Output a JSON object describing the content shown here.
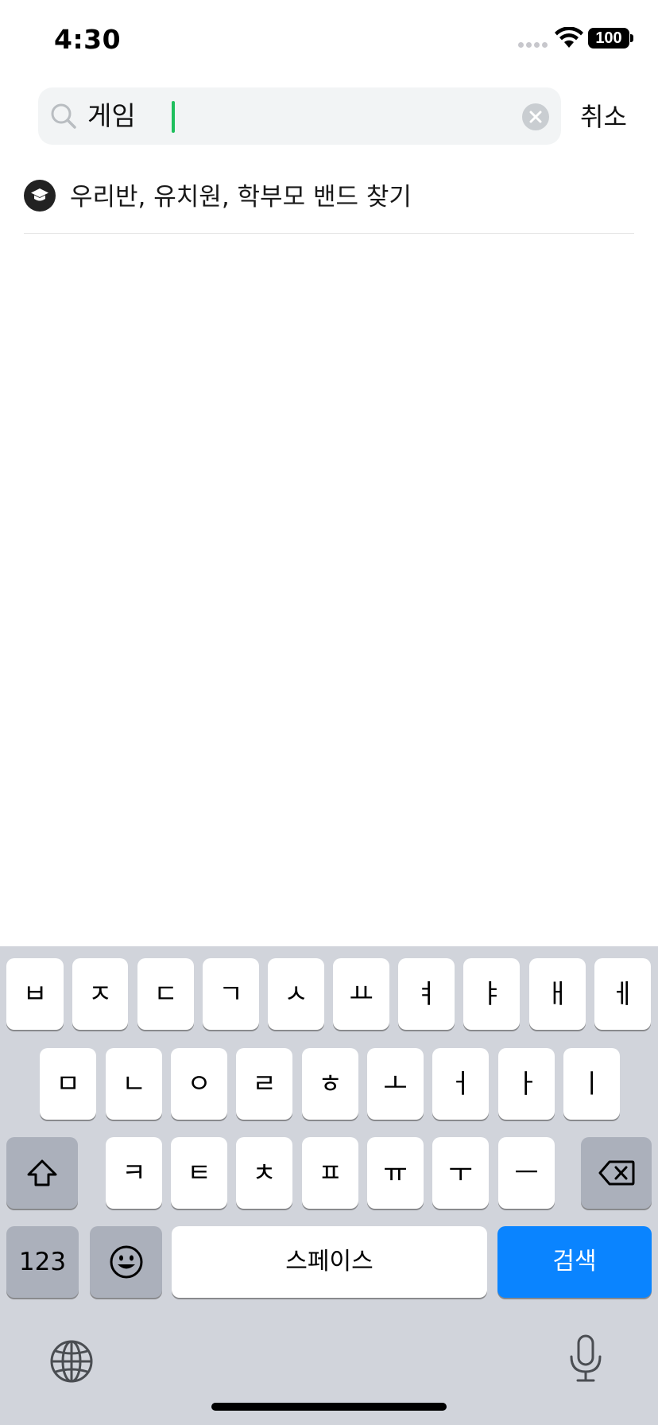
{
  "status_bar": {
    "time": "4:30",
    "battery": "100"
  },
  "search": {
    "query": "게임",
    "placeholder": "",
    "cancel_label": "취소"
  },
  "suggestion": {
    "icon": "graduation-cap-icon",
    "label": "우리반, 유치원, 학부모 밴드 찾기"
  },
  "keyboard": {
    "row1": [
      "ㅂ",
      "ㅈ",
      "ㄷ",
      "ㄱ",
      "ㅅ",
      "ㅛ",
      "ㅕ",
      "ㅑ",
      "ㅐ",
      "ㅔ"
    ],
    "row2": [
      "ㅁ",
      "ㄴ",
      "ㅇ",
      "ㄹ",
      "ㅎ",
      "ㅗ",
      "ㅓ",
      "ㅏ",
      "ㅣ"
    ],
    "row3": [
      "ㅋ",
      "ㅌ",
      "ㅊ",
      "ㅍ",
      "ㅠ",
      "ㅜ",
      "ㅡ"
    ],
    "numbers_label": "123",
    "space_label": "스페이스",
    "search_label": "검색",
    "icons": [
      "shift-icon",
      "backspace-icon",
      "emoji-icon",
      "globe-icon",
      "microphone-icon"
    ]
  },
  "colors": {
    "accent_caret": "#1fbf5d",
    "search_key": "#0a84ff",
    "keyboard_bg": "#d1d4db"
  }
}
